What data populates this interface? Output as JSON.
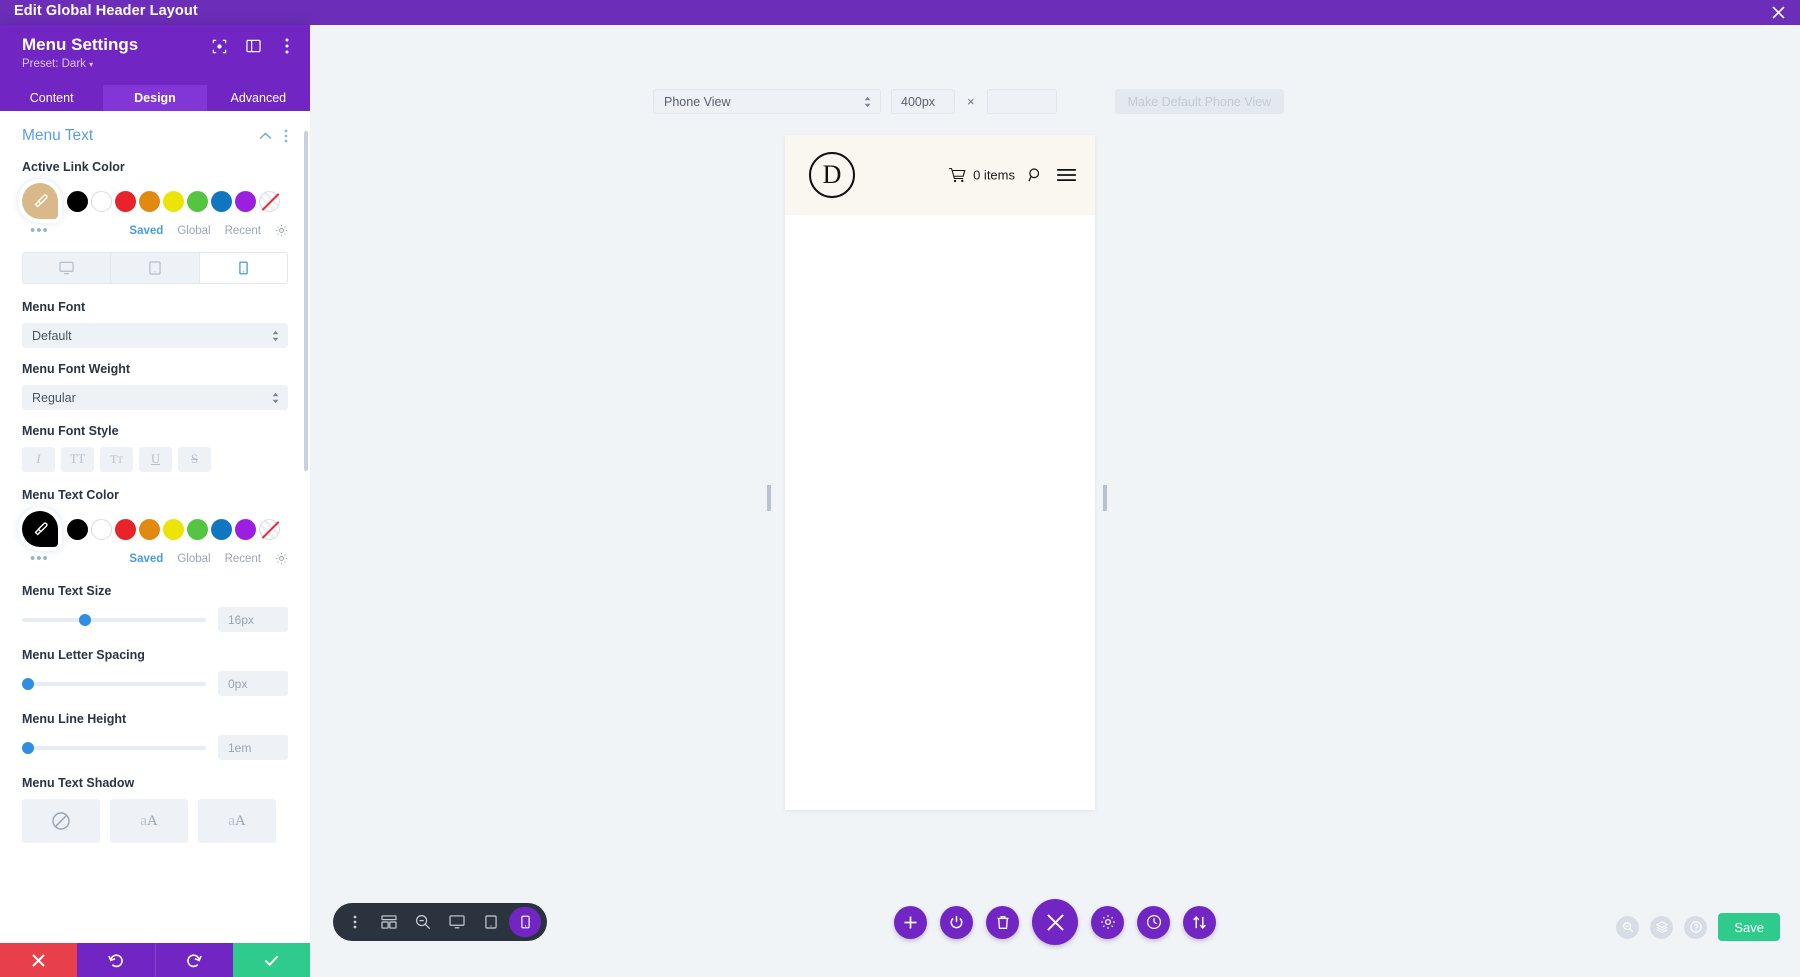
{
  "topbar": {
    "title": "Edit Global Header Layout",
    "close_label": "×"
  },
  "panel": {
    "title": "Menu Settings",
    "preset": "Preset: Dark",
    "header_icons": [
      {
        "name": "focus-icon"
      },
      {
        "name": "layout-panel-icon"
      },
      {
        "name": "more-vertical-icon"
      }
    ],
    "tabs": [
      {
        "label": "Content",
        "active": false
      },
      {
        "label": "Design",
        "active": true
      },
      {
        "label": "Advanced",
        "active": false
      }
    ],
    "section": {
      "title": "Menu Text"
    },
    "active_link_color": {
      "label": "Active Link Color",
      "active_swatch": "#d9b98a",
      "swatches": [
        "#000000",
        "#ffffff",
        "#e8232a",
        "#e08a11",
        "#ece407",
        "#55c441",
        "#1176c0",
        "#9b1fe0"
      ],
      "meta_tabs": [
        {
          "label": "Saved",
          "active": true
        },
        {
          "label": "Global",
          "active": false
        },
        {
          "label": "Recent",
          "active": false
        }
      ]
    },
    "device_tabs": [
      {
        "name": "desktop",
        "active": false
      },
      {
        "name": "tablet",
        "active": false
      },
      {
        "name": "phone",
        "active": true
      }
    ],
    "menu_font": {
      "label": "Menu Font",
      "value": "Default"
    },
    "menu_font_weight": {
      "label": "Menu Font Weight",
      "value": "Regular"
    },
    "menu_font_style": {
      "label": "Menu Font Style",
      "buttons": [
        {
          "name": "italic",
          "glyph": "I"
        },
        {
          "name": "uppercase",
          "glyph": "TT"
        },
        {
          "name": "small-caps",
          "glyph": "TT"
        },
        {
          "name": "underline",
          "glyph": "U"
        },
        {
          "name": "strikethrough",
          "glyph": "S"
        }
      ]
    },
    "menu_text_color": {
      "label": "Menu Text Color",
      "active_swatch": "#000000",
      "swatches": [
        "#000000",
        "#ffffff",
        "#e8232a",
        "#e08a11",
        "#ece407",
        "#55c441",
        "#1176c0",
        "#9b1fe0"
      ],
      "meta_tabs": [
        {
          "label": "Saved",
          "active": true
        },
        {
          "label": "Global",
          "active": false
        },
        {
          "label": "Recent",
          "active": false
        }
      ]
    },
    "menu_text_size": {
      "label": "Menu Text Size",
      "value": "16px",
      "knob_percent": 34
    },
    "menu_letter_spacing": {
      "label": "Menu Letter Spacing",
      "value": "0px",
      "knob_percent": 2
    },
    "menu_line_height": {
      "label": "Menu Line Height",
      "value": "1em",
      "knob_percent": 2
    },
    "menu_text_shadow": {
      "label": "Menu Text Shadow",
      "presets": [
        {
          "name": "none",
          "glyph": "⊘",
          "active": true
        },
        {
          "name": "shadow-soft",
          "glyph": "aA"
        },
        {
          "name": "shadow-hard",
          "glyph": "aA"
        }
      ]
    },
    "footer": [
      {
        "name": "discard-button",
        "glyph": "✕"
      },
      {
        "name": "undo-button",
        "glyph": "↺"
      },
      {
        "name": "redo-button",
        "glyph": "↻"
      },
      {
        "name": "apply-button",
        "glyph": "✓"
      }
    ]
  },
  "viewport_toolbar": {
    "view_select": "Phone View",
    "width_value": "400px",
    "times_symbol": "×",
    "height_value": "",
    "make_default_button": "Make Default Phone View"
  },
  "preview": {
    "logo_letter": "D",
    "cart_text": "0 items",
    "icons": [
      "cart-icon",
      "search-icon",
      "hamburger-icon"
    ]
  },
  "bottom_toolbar": {
    "items": [
      {
        "name": "drag-handle",
        "active": false
      },
      {
        "name": "wireframe-view",
        "active": false
      },
      {
        "name": "zoom-view",
        "active": false
      },
      {
        "name": "desktop-view",
        "active": false
      },
      {
        "name": "tablet-view",
        "active": false
      },
      {
        "name": "phone-view",
        "active": true
      }
    ]
  },
  "action_buttons": [
    {
      "name": "add-module",
      "glyph": "+"
    },
    {
      "name": "power-toggle",
      "glyph": "⏻"
    },
    {
      "name": "trash",
      "glyph": "🗑"
    },
    {
      "name": "close-menu",
      "glyph": "✕",
      "big": true
    },
    {
      "name": "settings",
      "glyph": "⚙"
    },
    {
      "name": "history",
      "glyph": "🕘"
    },
    {
      "name": "portability",
      "glyph": "⇅"
    }
  ],
  "right_controls": {
    "buttons": [
      {
        "name": "search-icon"
      },
      {
        "name": "layers-icon"
      },
      {
        "name": "help-icon"
      }
    ],
    "save_label": "Save"
  },
  "colors": {
    "purple": "#7126c4",
    "topbar_purple": "#6c2eb9",
    "accent_blue": "#2f8ee0",
    "green": "#2ecb8c",
    "red": "#e8404a",
    "canvas_bg": "#f1f4f7"
  }
}
